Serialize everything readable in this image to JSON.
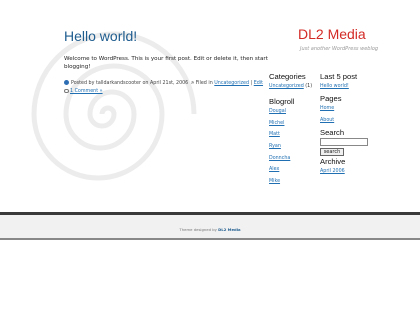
{
  "header": {
    "blog_name": "DL2 Media",
    "tagline": "Just another WordPress weblog"
  },
  "post": {
    "title": "Hello world!",
    "body": "Welcome to WordPress. This is your first post. Edit or delete it, then start blogging!",
    "posted_by_prefix": "Posted by",
    "author": "talldarkandscooter",
    "date_text": "on April 21st, 2006",
    "filed_in_prefix": "Filed in",
    "category": "Uncategorized",
    "separator": "|",
    "edit_label": "Edit",
    "comments_label": "1 Comment »"
  },
  "sidebar": {
    "categories": {
      "heading": "Categories",
      "items": [
        {
          "label": "Uncategorized",
          "count": "(1)"
        }
      ]
    },
    "blogroll": {
      "heading": "Blogroll",
      "items": [
        "Dougal",
        "Michel",
        "Matt",
        "Ryan",
        "Donncha",
        "Alex",
        "Mike"
      ]
    },
    "last_posts": {
      "heading": "Last 5 post",
      "items": [
        "Hello world!"
      ]
    },
    "pages": {
      "heading": "Pages",
      "items": [
        "Home",
        "About"
      ]
    },
    "search": {
      "heading": "Search",
      "input_value": "",
      "button_label": "search"
    },
    "archive": {
      "heading": "Archive",
      "items": [
        "April 2006"
      ]
    }
  },
  "footer": {
    "prefix": "Theme designed by",
    "link": "DL2 Media"
  },
  "colors": {
    "title_blue": "#1f5d8f",
    "brand_red": "#d32b26",
    "link_blue": "#1f6fb2",
    "footer_border": "#3a3a3a"
  },
  "icons": {
    "post_meta": "person-icon",
    "category": "pin-icon",
    "comments": "speech-bubble-icon",
    "background": "spiral-swirl-decoration"
  }
}
